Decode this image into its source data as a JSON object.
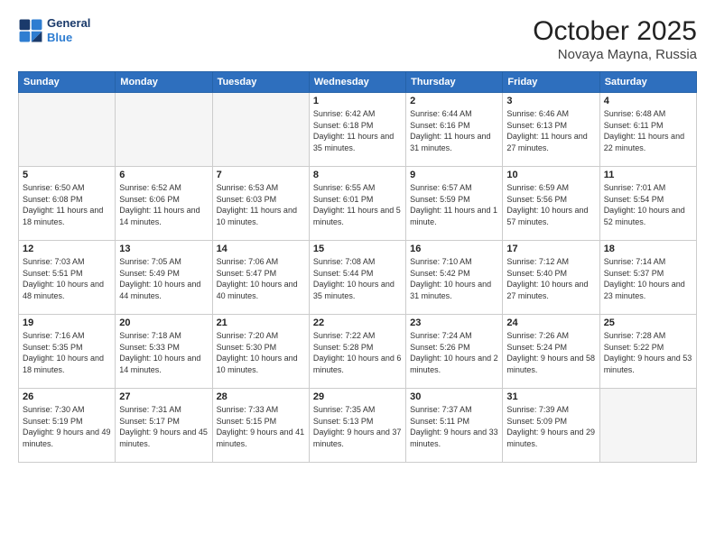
{
  "header": {
    "logo_line1": "General",
    "logo_line2": "Blue",
    "month": "October 2025",
    "location": "Novaya Mayna, Russia"
  },
  "days_of_week": [
    "Sunday",
    "Monday",
    "Tuesday",
    "Wednesday",
    "Thursday",
    "Friday",
    "Saturday"
  ],
  "weeks": [
    [
      {
        "num": "",
        "info": ""
      },
      {
        "num": "",
        "info": ""
      },
      {
        "num": "",
        "info": ""
      },
      {
        "num": "1",
        "info": "Sunrise: 6:42 AM\nSunset: 6:18 PM\nDaylight: 11 hours and 35 minutes."
      },
      {
        "num": "2",
        "info": "Sunrise: 6:44 AM\nSunset: 6:16 PM\nDaylight: 11 hours and 31 minutes."
      },
      {
        "num": "3",
        "info": "Sunrise: 6:46 AM\nSunset: 6:13 PM\nDaylight: 11 hours and 27 minutes."
      },
      {
        "num": "4",
        "info": "Sunrise: 6:48 AM\nSunset: 6:11 PM\nDaylight: 11 hours and 22 minutes."
      }
    ],
    [
      {
        "num": "5",
        "info": "Sunrise: 6:50 AM\nSunset: 6:08 PM\nDaylight: 11 hours and 18 minutes."
      },
      {
        "num": "6",
        "info": "Sunrise: 6:52 AM\nSunset: 6:06 PM\nDaylight: 11 hours and 14 minutes."
      },
      {
        "num": "7",
        "info": "Sunrise: 6:53 AM\nSunset: 6:03 PM\nDaylight: 11 hours and 10 minutes."
      },
      {
        "num": "8",
        "info": "Sunrise: 6:55 AM\nSunset: 6:01 PM\nDaylight: 11 hours and 5 minutes."
      },
      {
        "num": "9",
        "info": "Sunrise: 6:57 AM\nSunset: 5:59 PM\nDaylight: 11 hours and 1 minute."
      },
      {
        "num": "10",
        "info": "Sunrise: 6:59 AM\nSunset: 5:56 PM\nDaylight: 10 hours and 57 minutes."
      },
      {
        "num": "11",
        "info": "Sunrise: 7:01 AM\nSunset: 5:54 PM\nDaylight: 10 hours and 52 minutes."
      }
    ],
    [
      {
        "num": "12",
        "info": "Sunrise: 7:03 AM\nSunset: 5:51 PM\nDaylight: 10 hours and 48 minutes."
      },
      {
        "num": "13",
        "info": "Sunrise: 7:05 AM\nSunset: 5:49 PM\nDaylight: 10 hours and 44 minutes."
      },
      {
        "num": "14",
        "info": "Sunrise: 7:06 AM\nSunset: 5:47 PM\nDaylight: 10 hours and 40 minutes."
      },
      {
        "num": "15",
        "info": "Sunrise: 7:08 AM\nSunset: 5:44 PM\nDaylight: 10 hours and 35 minutes."
      },
      {
        "num": "16",
        "info": "Sunrise: 7:10 AM\nSunset: 5:42 PM\nDaylight: 10 hours and 31 minutes."
      },
      {
        "num": "17",
        "info": "Sunrise: 7:12 AM\nSunset: 5:40 PM\nDaylight: 10 hours and 27 minutes."
      },
      {
        "num": "18",
        "info": "Sunrise: 7:14 AM\nSunset: 5:37 PM\nDaylight: 10 hours and 23 minutes."
      }
    ],
    [
      {
        "num": "19",
        "info": "Sunrise: 7:16 AM\nSunset: 5:35 PM\nDaylight: 10 hours and 18 minutes."
      },
      {
        "num": "20",
        "info": "Sunrise: 7:18 AM\nSunset: 5:33 PM\nDaylight: 10 hours and 14 minutes."
      },
      {
        "num": "21",
        "info": "Sunrise: 7:20 AM\nSunset: 5:30 PM\nDaylight: 10 hours and 10 minutes."
      },
      {
        "num": "22",
        "info": "Sunrise: 7:22 AM\nSunset: 5:28 PM\nDaylight: 10 hours and 6 minutes."
      },
      {
        "num": "23",
        "info": "Sunrise: 7:24 AM\nSunset: 5:26 PM\nDaylight: 10 hours and 2 minutes."
      },
      {
        "num": "24",
        "info": "Sunrise: 7:26 AM\nSunset: 5:24 PM\nDaylight: 9 hours and 58 minutes."
      },
      {
        "num": "25",
        "info": "Sunrise: 7:28 AM\nSunset: 5:22 PM\nDaylight: 9 hours and 53 minutes."
      }
    ],
    [
      {
        "num": "26",
        "info": "Sunrise: 7:30 AM\nSunset: 5:19 PM\nDaylight: 9 hours and 49 minutes."
      },
      {
        "num": "27",
        "info": "Sunrise: 7:31 AM\nSunset: 5:17 PM\nDaylight: 9 hours and 45 minutes."
      },
      {
        "num": "28",
        "info": "Sunrise: 7:33 AM\nSunset: 5:15 PM\nDaylight: 9 hours and 41 minutes."
      },
      {
        "num": "29",
        "info": "Sunrise: 7:35 AM\nSunset: 5:13 PM\nDaylight: 9 hours and 37 minutes."
      },
      {
        "num": "30",
        "info": "Sunrise: 7:37 AM\nSunset: 5:11 PM\nDaylight: 9 hours and 33 minutes."
      },
      {
        "num": "31",
        "info": "Sunrise: 7:39 AM\nSunset: 5:09 PM\nDaylight: 9 hours and 29 minutes."
      },
      {
        "num": "",
        "info": ""
      }
    ]
  ]
}
